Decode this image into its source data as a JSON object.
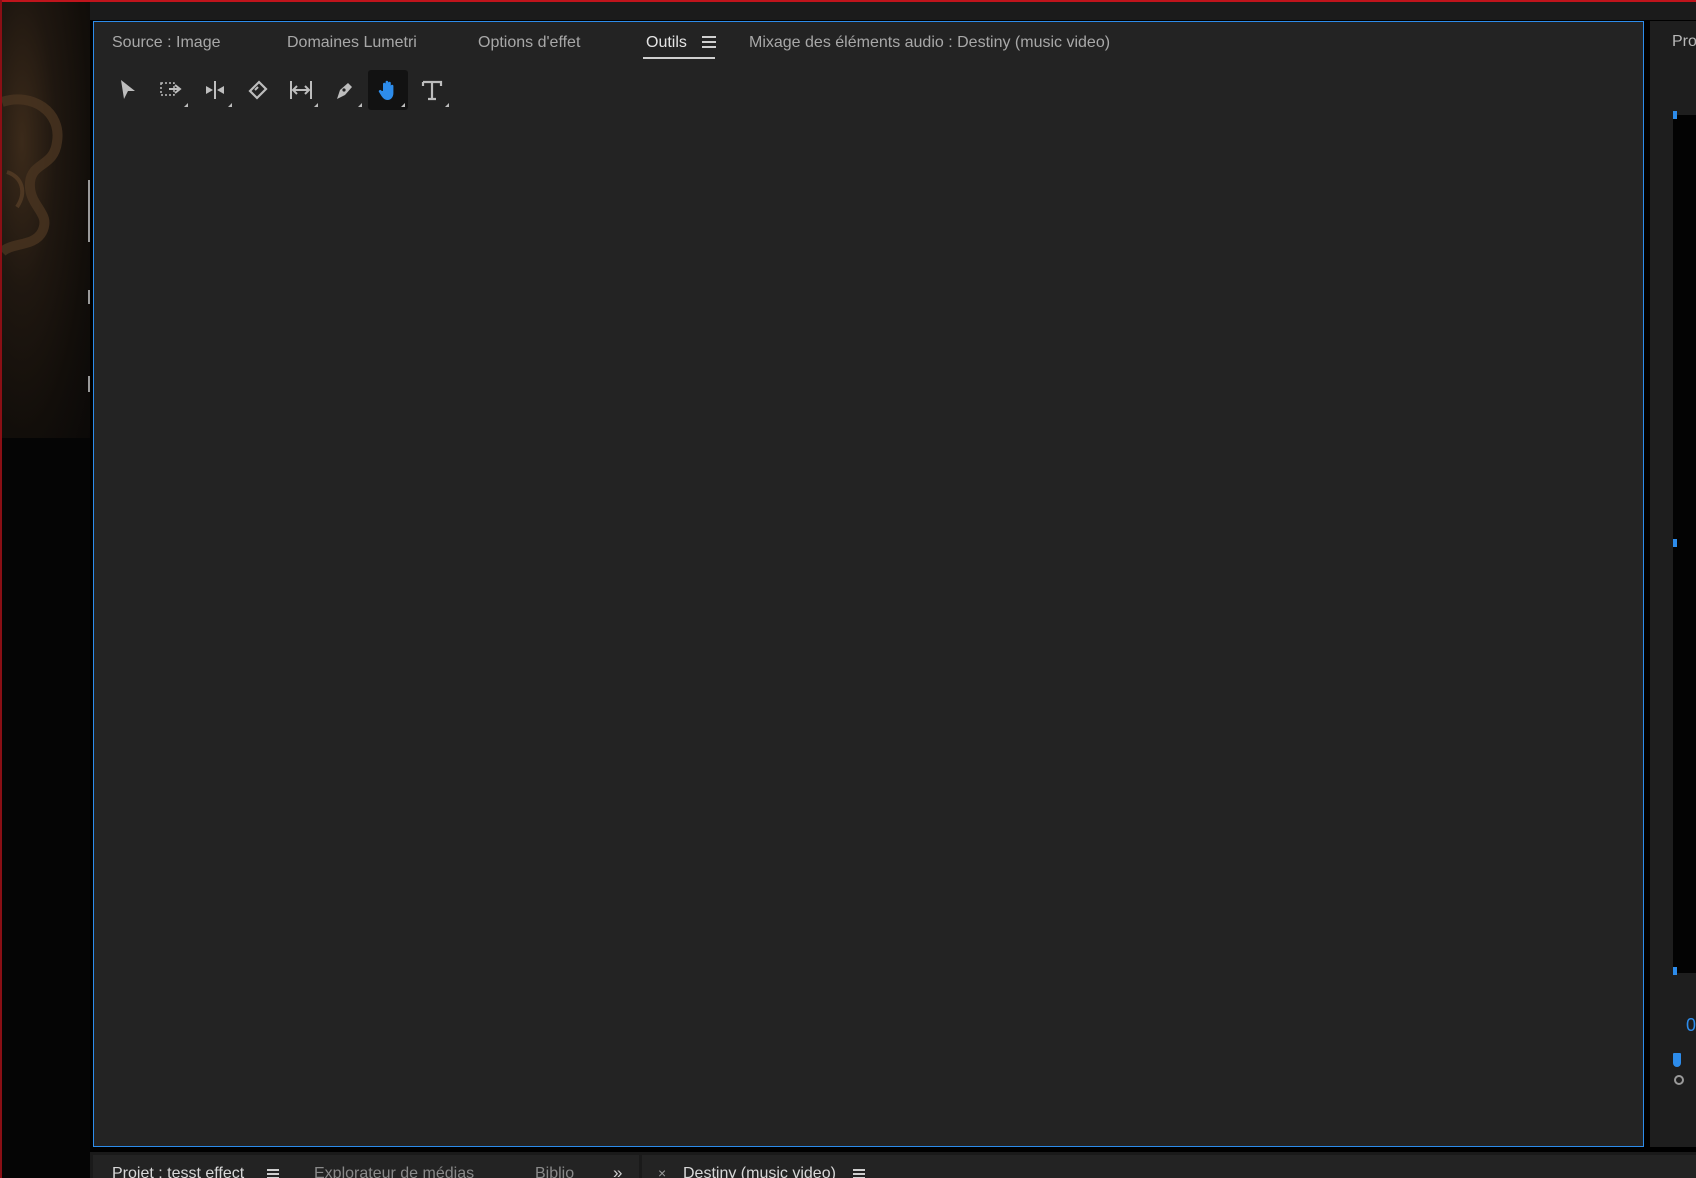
{
  "panel": {
    "tabs": [
      {
        "label": "Source : Image",
        "active": false
      },
      {
        "label": "Domaines Lumetri",
        "active": false
      },
      {
        "label": "Options d'effet",
        "active": false
      },
      {
        "label": "Outils",
        "active": true
      },
      {
        "label": "Mixage des éléments audio : Destiny (music video)",
        "active": false
      }
    ],
    "tools": [
      {
        "name": "selection-tool",
        "icon": "arrow-pointer-icon",
        "selected": false
      },
      {
        "name": "track-select-tool",
        "icon": "track-select-forward-icon",
        "selected": false
      },
      {
        "name": "ripple-edit-tool",
        "icon": "ripple-edit-icon",
        "selected": false
      },
      {
        "name": "razor-tool",
        "icon": "razor-icon",
        "selected": false
      },
      {
        "name": "slip-tool",
        "icon": "slip-icon",
        "selected": false
      },
      {
        "name": "pen-tool",
        "icon": "pen-icon",
        "selected": false
      },
      {
        "name": "hand-tool",
        "icon": "hand-icon",
        "selected": true
      },
      {
        "name": "type-tool",
        "icon": "type-icon",
        "selected": false
      }
    ]
  },
  "right_panel": {
    "tab_label": "Pro",
    "timecode_fragment": "0"
  },
  "bottom": {
    "project_tab": "Projet : tesst effect",
    "media_browser_tab": "Explorateur de médias",
    "library_tab": "Biblio",
    "sequence_tab": "Destiny (music video)"
  },
  "colors": {
    "accent": "#2d8ceb",
    "panel_bg": "#232323",
    "window_border": "#c0141c"
  }
}
